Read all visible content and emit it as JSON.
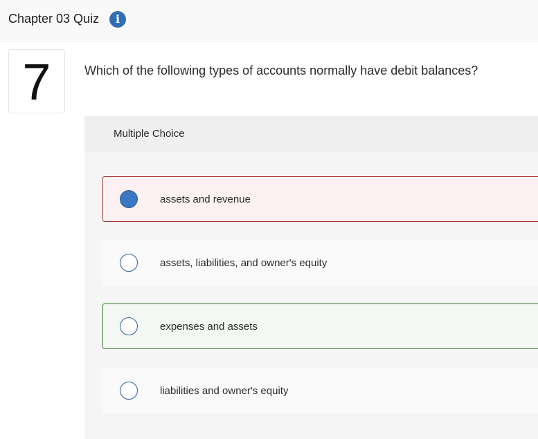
{
  "header": {
    "title": "Chapter 03 Quiz",
    "info_icon": "info-icon",
    "info_glyph": "i"
  },
  "question": {
    "number": "7",
    "text": "Which of the following types of accounts normally have debit balances?"
  },
  "answer_panel": {
    "type_label": "Multiple Choice",
    "choices": [
      {
        "label": "assets and revenue",
        "selected": true,
        "status": "incorrect"
      },
      {
        "label": "assets, liabilities, and owner's equity",
        "selected": false,
        "status": "neutral"
      },
      {
        "label": "expenses and assets",
        "selected": false,
        "status": "correct"
      },
      {
        "label": "liabilities and owner's equity",
        "selected": false,
        "status": "neutral"
      }
    ]
  },
  "colors": {
    "accent": "#2f6eb5",
    "incorrect_border": "#a8302f",
    "correct_border": "#3b7d32"
  }
}
